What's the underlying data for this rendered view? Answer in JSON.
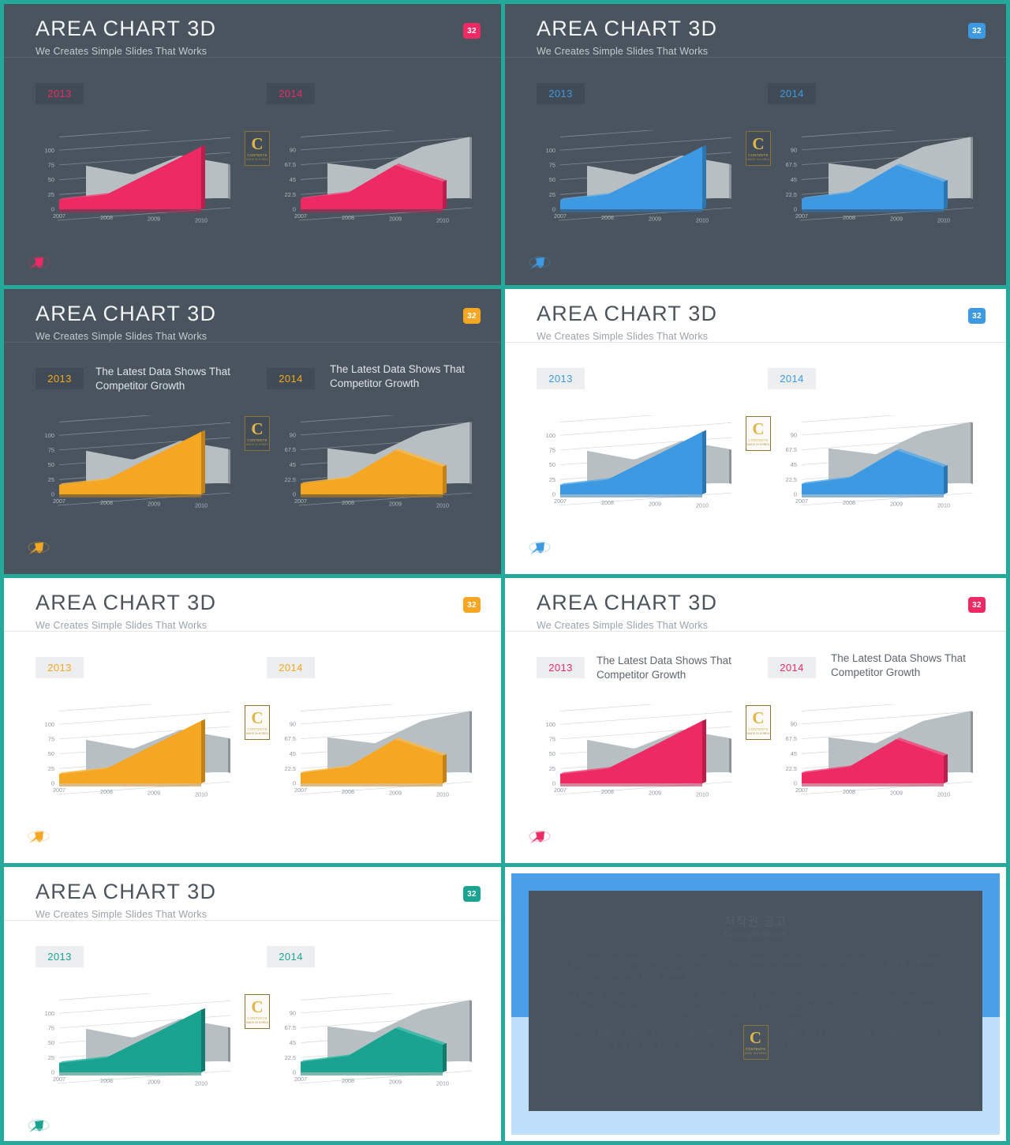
{
  "meta": {
    "title": "AREA CHART 3D",
    "subtitle": "We Creates Simple Slides That Works",
    "badge_label": "32",
    "year_left": "2013",
    "year_right": "2014",
    "description": "The Latest Data Shows That Competitor Growth",
    "logo_letter": "C",
    "logo_line1": "CONTENTS",
    "logo_line2": "MADE IN KOREA",
    "colors": {
      "pink": "#ed2a63",
      "blue": "#3d9ae2",
      "orange": "#f5a623",
      "teal": "#1aa391",
      "gray_series": "#b8bfc2",
      "dark_bg": "#4a545e",
      "light_bg": "#ffffff",
      "frame_teal": "#25a99a",
      "frame_blue": "#4a9fe8"
    }
  },
  "slides": [
    {
      "id": "s1",
      "theme": "dark",
      "accent": "pink",
      "badge": "32",
      "has_description": false
    },
    {
      "id": "s2",
      "theme": "dark",
      "accent": "blue",
      "badge": "32",
      "has_description": false
    },
    {
      "id": "s3",
      "theme": "dark",
      "accent": "orange",
      "badge": "32",
      "has_description": true
    },
    {
      "id": "s4",
      "theme": "light",
      "accent": "blue",
      "badge": "32",
      "has_description": false
    },
    {
      "id": "s5",
      "theme": "light",
      "accent": "orange",
      "badge": "32",
      "has_description": false
    },
    {
      "id": "s6",
      "theme": "light",
      "accent": "pink",
      "badge": "32",
      "has_description": true
    },
    {
      "id": "s7",
      "theme": "light",
      "accent": "teal",
      "badge": "32",
      "has_description": false
    }
  ],
  "copyright": {
    "title": "저작권 공고",
    "subtitle": "Copyright Notice",
    "paragraphs": [
      "본 저작물은 저작권법에 의하여 보호받는 저작물이므로 무단 전재와 무단 복제를 금지하며, 내용의 전부 또는 일부를 이용하려면 반드시 저작권자의 서면 동의를 받아야 합니다.",
      "본 템플릿에 사용된 모든 이미지 및 아이콘, 폰트의 저작권은 각 제작사에 있으며 상업적 용도로 재배포하거나 판매할 수 없습니다. 구매하신 고객님께서는 개인 및 기업 내부 문서 작성 용도로만 사용이 가능합니다.",
      "구매하신 템플릿은 재판매, 공유, 배포가 불가하며 이를 위반할 경우 저작권법에 의거 민형사상의 책임을 지게 됩니다. 문의사항은 고객센터를 통해 접수하여 주시기 바라며 빠른 시간 내에 답변 드리도록 하겠습니다."
    ]
  },
  "chart_data": [
    {
      "type": "area",
      "id": "chart-2013",
      "title": "2013",
      "categories": [
        "2007",
        "2008",
        "2009",
        "2010"
      ],
      "yticks": [
        0,
        25,
        50,
        75,
        100
      ],
      "ylim": [
        0,
        115
      ],
      "series": [
        {
          "name": "gray-series",
          "values": [
            55,
            40,
            72,
            58
          ]
        },
        {
          "name": "accent-series",
          "values": [
            16,
            25,
            65,
            106
          ]
        }
      ],
      "xlabel": "",
      "ylabel": "",
      "grid": true,
      "legend": "none"
    },
    {
      "type": "area",
      "id": "chart-2014",
      "title": "2014",
      "categories": [
        "2007",
        "2008",
        "2009",
        "2010"
      ],
      "yticks": [
        0,
        22.5,
        45,
        67.5,
        90
      ],
      "ylim": [
        0,
        103
      ],
      "series": [
        {
          "name": "gray-series",
          "values": [
            53,
            44,
            78,
            93
          ]
        },
        {
          "name": "accent-series",
          "values": [
            16,
            25,
            67,
            42
          ]
        }
      ],
      "xlabel": "",
      "ylabel": "",
      "grid": true,
      "legend": "none"
    }
  ]
}
